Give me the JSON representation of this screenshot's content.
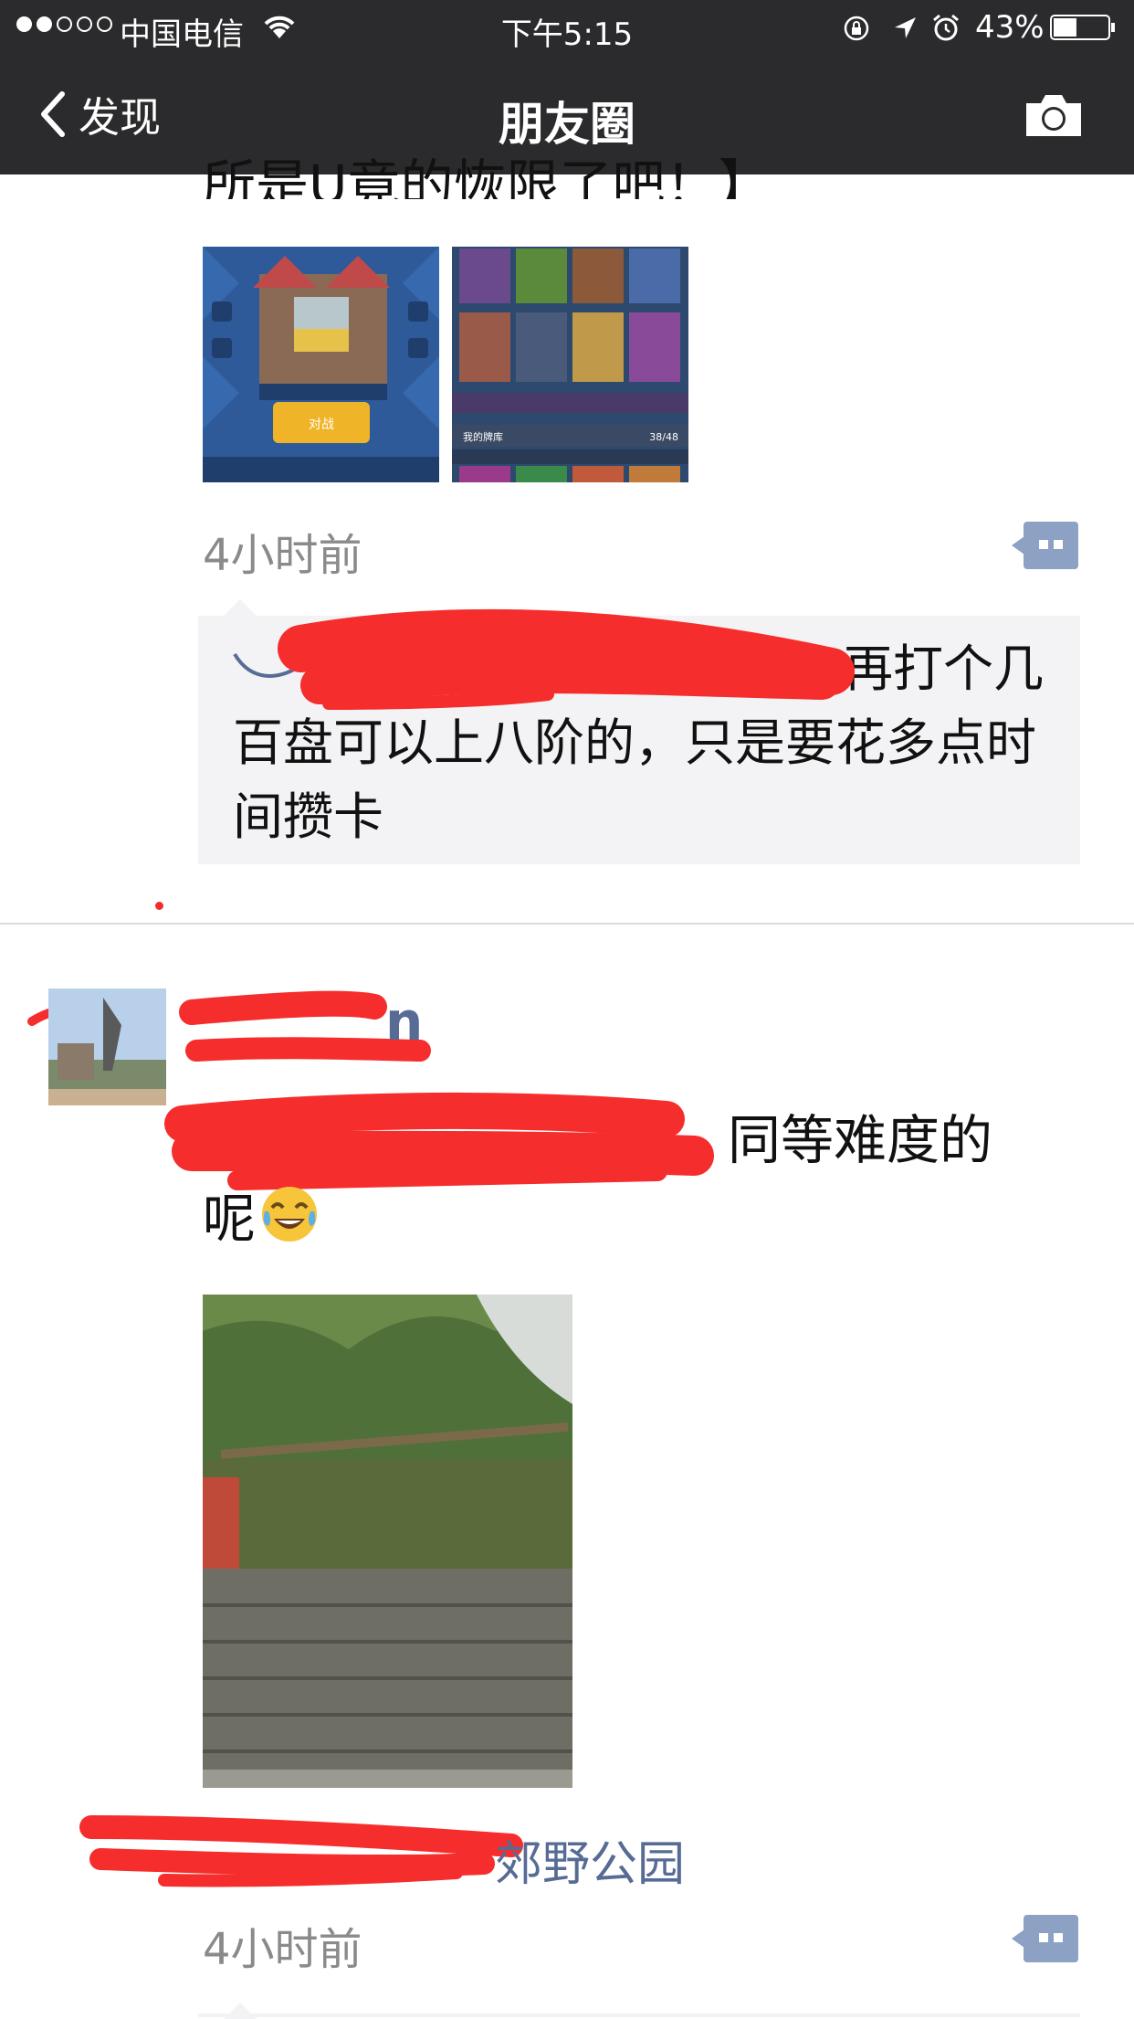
{
  "status_bar": {
    "carrier": "中国电信",
    "time": "下午5:15",
    "battery": "43%",
    "battery_level": 0.43,
    "signal_bars": 2,
    "icons": [
      "wifi-icon",
      "orientation-lock-icon",
      "location-arrow-icon",
      "alarm-icon",
      "battery-icon"
    ]
  },
  "nav": {
    "back_label": "发现",
    "title": "朋友圈",
    "camera_icon": "camera-icon"
  },
  "post1": {
    "cut_text": "所是U竟的恢限了吧！】",
    "time": "4小时前",
    "comment_text": "再打个几百盘可以上八阶的，只是要花多点时间攒卡",
    "image_labels": [
      "对战",
      "我的牌库",
      "38/48"
    ]
  },
  "post2": {
    "username_visible": "n",
    "text_visible_a": "同等难度的",
    "text_visible_b": "呢",
    "location": "郊野公园",
    "time": "4小时前"
  },
  "colors": {
    "nav_bg": "#2b2b2d",
    "link_blue": "#576b95",
    "comment_bg": "#f3f3f5",
    "redaction": "#f52d2d"
  }
}
